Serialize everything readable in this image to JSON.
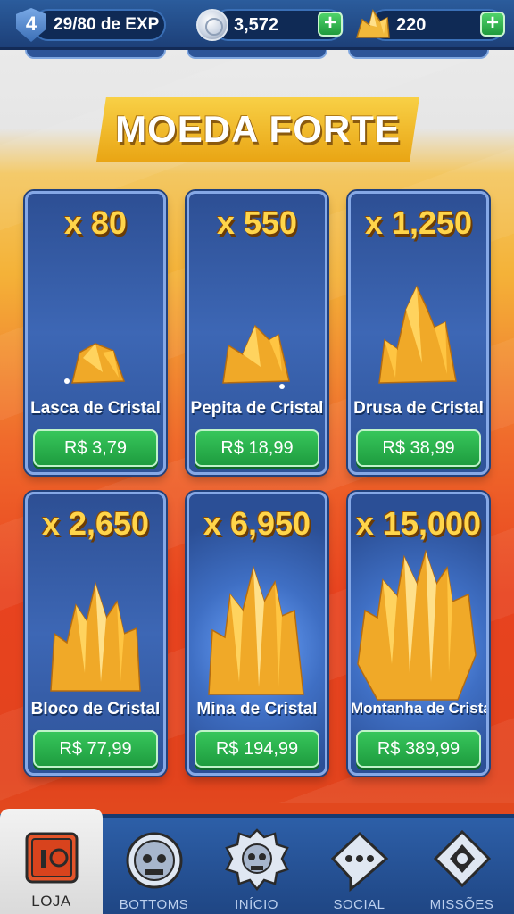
{
  "topbar": {
    "level": "4",
    "exp_text": "29/80 de EXP",
    "coins": "3,572",
    "gold": "220",
    "level_icon": "shield-icon",
    "coin_icon": "silver-coin-icon",
    "gold_icon": "gold-crystal-icon",
    "plus_label": "+"
  },
  "section": {
    "title": "MOEDA FORTE"
  },
  "products": [
    {
      "qty": "x 80",
      "name": "Lasca de Cristal",
      "price": "R$ 3,79"
    },
    {
      "qty": "x 550",
      "name": "Pepita de Cristal",
      "price": "R$ 18,99"
    },
    {
      "qty": "x 1,250",
      "name": "Drusa de Cristal",
      "price": "R$ 38,99"
    },
    {
      "qty": "x 2,650",
      "name": "Bloco de Cristal",
      "price": "R$ 77,99"
    },
    {
      "qty": "x 6,950",
      "name": "Mina de Cristal",
      "price": "R$ 194,99"
    },
    {
      "qty": "x 15,000",
      "name": "Montanha de Cristal",
      "price": "R$ 389,99"
    }
  ],
  "nav": {
    "items": [
      {
        "label": "LOJA",
        "icon": "shop-crate-icon",
        "active": true
      },
      {
        "label": "BOTTOMS",
        "icon": "robot-head-icon",
        "active": false
      },
      {
        "label": "INÍCIO",
        "icon": "skull-gear-icon",
        "active": false
      },
      {
        "label": "SOCIAL",
        "icon": "chat-bubble-icon",
        "active": false
      },
      {
        "label": "MISSÕES",
        "icon": "mission-emblem-icon",
        "active": false
      }
    ]
  },
  "colors": {
    "accent_blue": "#2b5c9c",
    "title_gold": "#f8d046",
    "price_green": "#1e9c3f",
    "qty_yellow": "#ffd54a"
  }
}
